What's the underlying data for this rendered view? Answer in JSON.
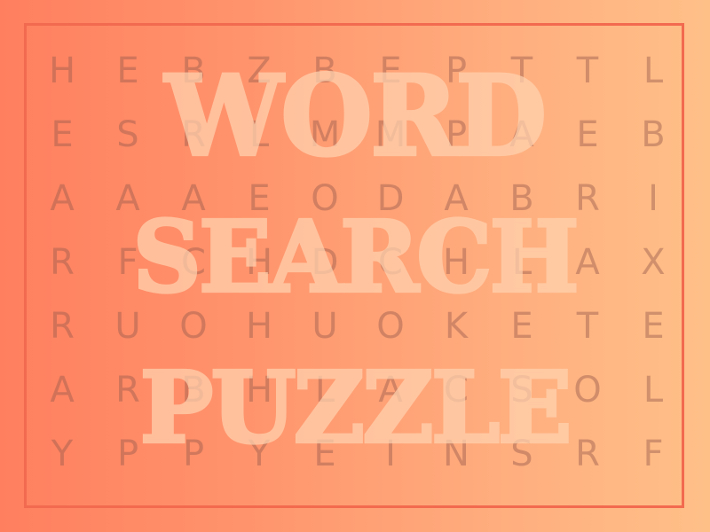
{
  "title": {
    "line1": "WORD",
    "line2": "SEARCH",
    "line3": "PUZZLE"
  },
  "grid": [
    [
      "H",
      "E",
      "B",
      "Z",
      "B",
      "E",
      "P",
      "T",
      "T",
      "L"
    ],
    [
      "E",
      "S",
      "R",
      "L",
      "M",
      "M",
      "P",
      "A",
      "E",
      "B"
    ],
    [
      "A",
      "A",
      "A",
      "E",
      "O",
      "D",
      "A",
      "B",
      "R",
      "I"
    ],
    [
      "R",
      "F",
      "C",
      "H",
      "D",
      "C",
      "H",
      "L",
      "A",
      "X"
    ],
    [
      "R",
      "U",
      "O",
      "H",
      "U",
      "O",
      "K",
      "E",
      "T",
      "E"
    ],
    [
      "A",
      "R",
      "B",
      "H",
      "L",
      "A",
      "C",
      "S",
      "O",
      "L"
    ],
    [
      "Y",
      "P",
      "P",
      "Y",
      "E",
      "I",
      "N",
      "S",
      "R",
      "F"
    ]
  ],
  "colors": {
    "background_left": "#ff7f5f",
    "background_right": "#ffc088",
    "frame": "#f26a4f",
    "title": "#ffd3b0",
    "grid_letters": "#9a5d4e"
  }
}
